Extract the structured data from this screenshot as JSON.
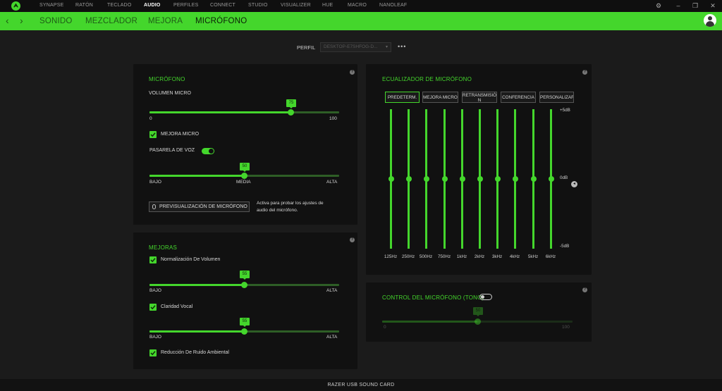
{
  "colors": {
    "accent": "#44d62c",
    "panel": "#111111",
    "background": "#1b1b1b"
  },
  "topnav": {
    "items": [
      "SYNAPSE",
      "RATÓN",
      "TECLADO",
      "AUDIO",
      "PERFILES",
      "CONNECT",
      "STUDIO",
      "VISUALIZER",
      "HUE",
      "MACRO",
      "NANOLEAF"
    ],
    "active": "AUDIO"
  },
  "subnav": {
    "tabs": [
      "SONIDO",
      "MEZCLADOR",
      "MEJORA",
      "MICRÓFONO"
    ],
    "active": "MICRÓFONO"
  },
  "profile": {
    "label": "PERFIL",
    "value": "DESKTOP-E7SHFOG-D...",
    "more": "•••"
  },
  "mic_panel": {
    "title": "MICRÓFONO",
    "volume_label": "VOLUMEN MICRO",
    "volume_value": "75",
    "volume_min": "0",
    "volume_max": "100",
    "enhance_label": "MEJORA MICRO",
    "enhance_checked": true,
    "voice_gate_label": "PASARELA DE VOZ",
    "voice_gate_on": true,
    "gate_value": "50",
    "gate_low": "BAJO",
    "gate_mid": "MEDIA",
    "gate_high": "ALTA",
    "preview_button": "PREVISUALIZACIÓN DE MICRÓFONO",
    "preview_hint_line1": "Activa para probar los ajustes de",
    "preview_hint_line2": "audio del micrófono."
  },
  "improvements_panel": {
    "title": "MEJORAS",
    "items": [
      {
        "label": "Normalización De Volumen",
        "checked": true,
        "value": "55",
        "low": "BAJO",
        "high": "ALTA"
      },
      {
        "label": "Claridad Vocal",
        "checked": true,
        "value": "55",
        "low": "BAJO",
        "high": "ALTA"
      },
      {
        "label": "Reducción De Ruido Ambiental",
        "checked": true
      }
    ]
  },
  "eq_panel": {
    "title": "ECUALIZADOR DE MICRÓFONO",
    "presets": [
      "PREDETERM.",
      "MEJORA MICRO",
      "RETRANSMISIÓ N",
      "CONFERENCIA",
      "PERSONALIZAR"
    ],
    "active_preset": "PREDETERM.",
    "bands": [
      {
        "freq": "125Hz",
        "gain_db": 0
      },
      {
        "freq": "250Hz",
        "gain_db": 0
      },
      {
        "freq": "500Hz",
        "gain_db": 0
      },
      {
        "freq": "750Hz",
        "gain_db": 0
      },
      {
        "freq": "1kHz",
        "gain_db": 0
      },
      {
        "freq": "2kHz",
        "gain_db": 0
      },
      {
        "freq": "3kHz",
        "gain_db": 0
      },
      {
        "freq": "4kHz",
        "gain_db": 0
      },
      {
        "freq": "5kHz",
        "gain_db": 0
      },
      {
        "freq": "6kHz",
        "gain_db": 0
      }
    ],
    "db_top": "+5dB",
    "db_mid": "0dB",
    "db_bottom": "-5dB"
  },
  "tone_panel": {
    "title": "CONTROL DEL MICRÓFONO (TONO)",
    "enabled": false,
    "value": "50",
    "min": "0",
    "max": "100"
  },
  "footer": {
    "device": "RAZER USB SOUND CARD"
  },
  "help_icon": "?"
}
